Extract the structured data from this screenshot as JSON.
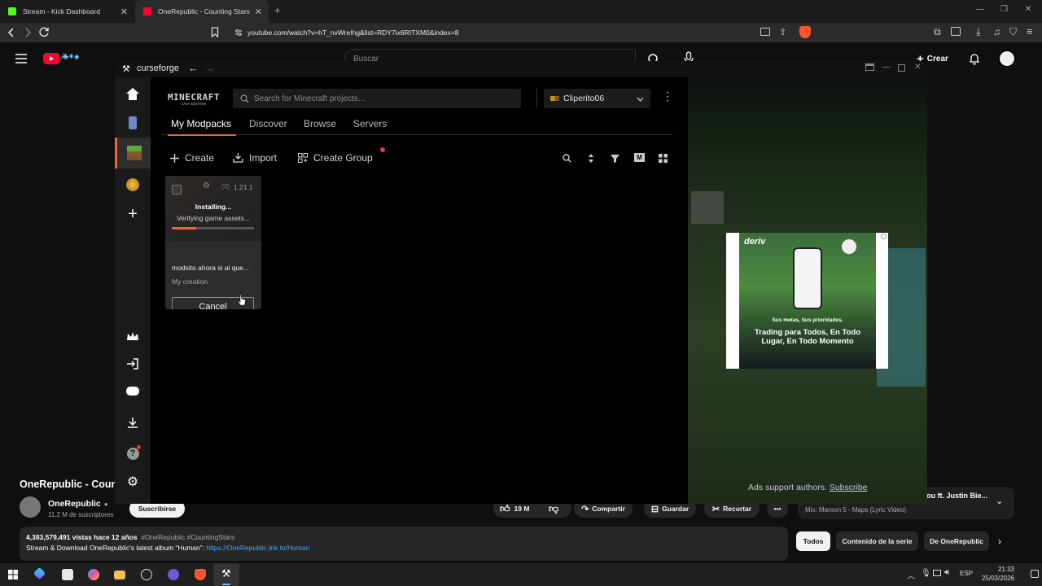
{
  "browser": {
    "tabs": [
      {
        "title": "Stream - Kick Dashboard",
        "favicon_color": "#53fc18"
      },
      {
        "title": "OneRepublic - Counting Stars",
        "favicon_color": "#ff0033",
        "active": true
      }
    ],
    "url": "youtube.com/watch?v=hT_nvWreIhg&list=RDY7ix6RITXM0&index=8"
  },
  "youtube": {
    "search_placeholder": "Buscar",
    "create_label": "Crear",
    "video_title": "OneRepublic - Coun",
    "channel_name": "OneRepublic",
    "subscribers": "11.2 M de suscriptores",
    "subscribe_label": "Suscribirse",
    "likes": "19 M",
    "share_label": "Compartir",
    "save_label": "Guardar",
    "clip_label": "Recortar",
    "stats": "4,383,579,491 vistas  hace 12 años",
    "hashtags": "#OneRepublic #CountingStars",
    "description_line": "Stream & Download OneRepublic's latest album “Human”:",
    "description_link": "https://OneRepublic.lnk.to/Human",
    "side_video_title": "ou ft. Justin Bie...",
    "mix_label": "Mix: Maroon 5 - Maps (Lyric Video)",
    "chips": [
      "Todos",
      "Contenido de la serie",
      "De OneRepublic"
    ]
  },
  "curseforge": {
    "app_name": "curseforge",
    "game_logo_text": "MINECRAFT",
    "game_logo_sub": "JAVA EDITION",
    "search_placeholder": "Search for Minecraft projects...",
    "profile_name": "Cliperito06",
    "tabs": [
      "My Modpacks",
      "Discover",
      "Browse",
      "Servers"
    ],
    "toolbar": {
      "create": "Create",
      "import": "Import",
      "create_group": "Create Group"
    },
    "card": {
      "version": "1.21.1",
      "status": "Installing...",
      "substatus": "Verifying game assets...",
      "progress": 0.3,
      "name": "modsito ahora si al que...",
      "author": "My creation",
      "cancel_label": "Cancel"
    },
    "ad": {
      "brand": "deriv",
      "slogan_small": "Sus metas, Sus prioridades.",
      "slogan_big": "Trading para Todos, En Todo Lugar, En Todo Momento",
      "footer_text": "Ads support authors.",
      "subscribe_link": "Subscribe"
    }
  },
  "taskbar": {
    "language": "ESP",
    "time": "21:33",
    "date": "25/03/2026"
  }
}
